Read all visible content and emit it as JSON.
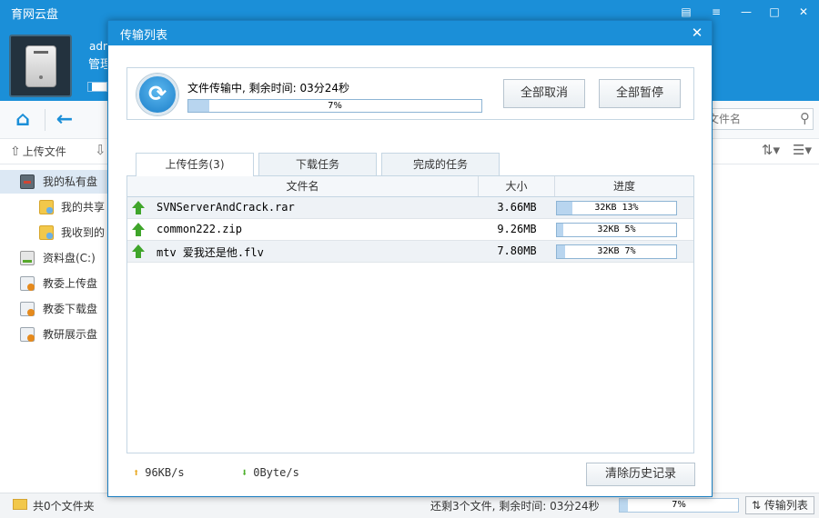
{
  "app": {
    "title": "育网云盘",
    "window_buttons": [
      "feedback-icon",
      "menu-icon",
      "minimize-icon",
      "maximize-icon",
      "close-icon"
    ]
  },
  "user": {
    "name": "adm",
    "role": "管理"
  },
  "search": {
    "placeholder": "文件名"
  },
  "toolbar": {
    "upload_label": "上传文件"
  },
  "sidebar": {
    "items": [
      {
        "label": "我的私有盘",
        "icon": "private-disk-icon"
      },
      {
        "label": "我的共享",
        "icon": "shared-folder-icon"
      },
      {
        "label": "我收到的",
        "icon": "received-folder-icon"
      },
      {
        "label": "资料盘(C:)",
        "icon": "drive-c-icon"
      },
      {
        "label": "教委上传盘",
        "icon": "network-disk-icon"
      },
      {
        "label": "教委下载盘",
        "icon": "network-disk-icon"
      },
      {
        "label": "教研展示盘",
        "icon": "network-disk-icon"
      }
    ]
  },
  "statusbar": {
    "folder_count": "共0个文件夹",
    "remaining": "还剩3个文件, 剩余时间: 03分24秒",
    "progress_label": "7%",
    "progress": 0.07,
    "transfer_button": "传输列表"
  },
  "dialog": {
    "title": "传输列表",
    "summary": {
      "text": "文件传输中, 剩余时间: 03分24秒",
      "progress_label": "7%",
      "progress": 0.07
    },
    "cancel_all": "全部取消",
    "pause_all": "全部暂停",
    "tabs": [
      {
        "label": "上传任务(3)",
        "active": true
      },
      {
        "label": "下载任务",
        "active": false
      },
      {
        "label": "完成的任务",
        "active": false
      }
    ],
    "columns": [
      "文件名",
      "大小",
      "进度"
    ],
    "rows": [
      {
        "name": "SVNServerAndCrack.rar",
        "size": "3.66MB",
        "progress_text": "32KB 13%",
        "progress": 0.13
      },
      {
        "name": "common222.zip",
        "size": "9.26MB",
        "progress_text": "32KB 5%",
        "progress": 0.05
      },
      {
        "name": "mtv 爱我还是他.flv",
        "size": "7.80MB",
        "progress_text": "32KB 7%",
        "progress": 0.07
      }
    ],
    "upload_speed": "96KB/s",
    "download_speed": "0Byte/s",
    "clear_history": "清除历史记录"
  },
  "colors": {
    "accent": "#1b8fd8",
    "progress_fill": "#b8d5ef",
    "upload_arrow": "#3fa52a"
  }
}
